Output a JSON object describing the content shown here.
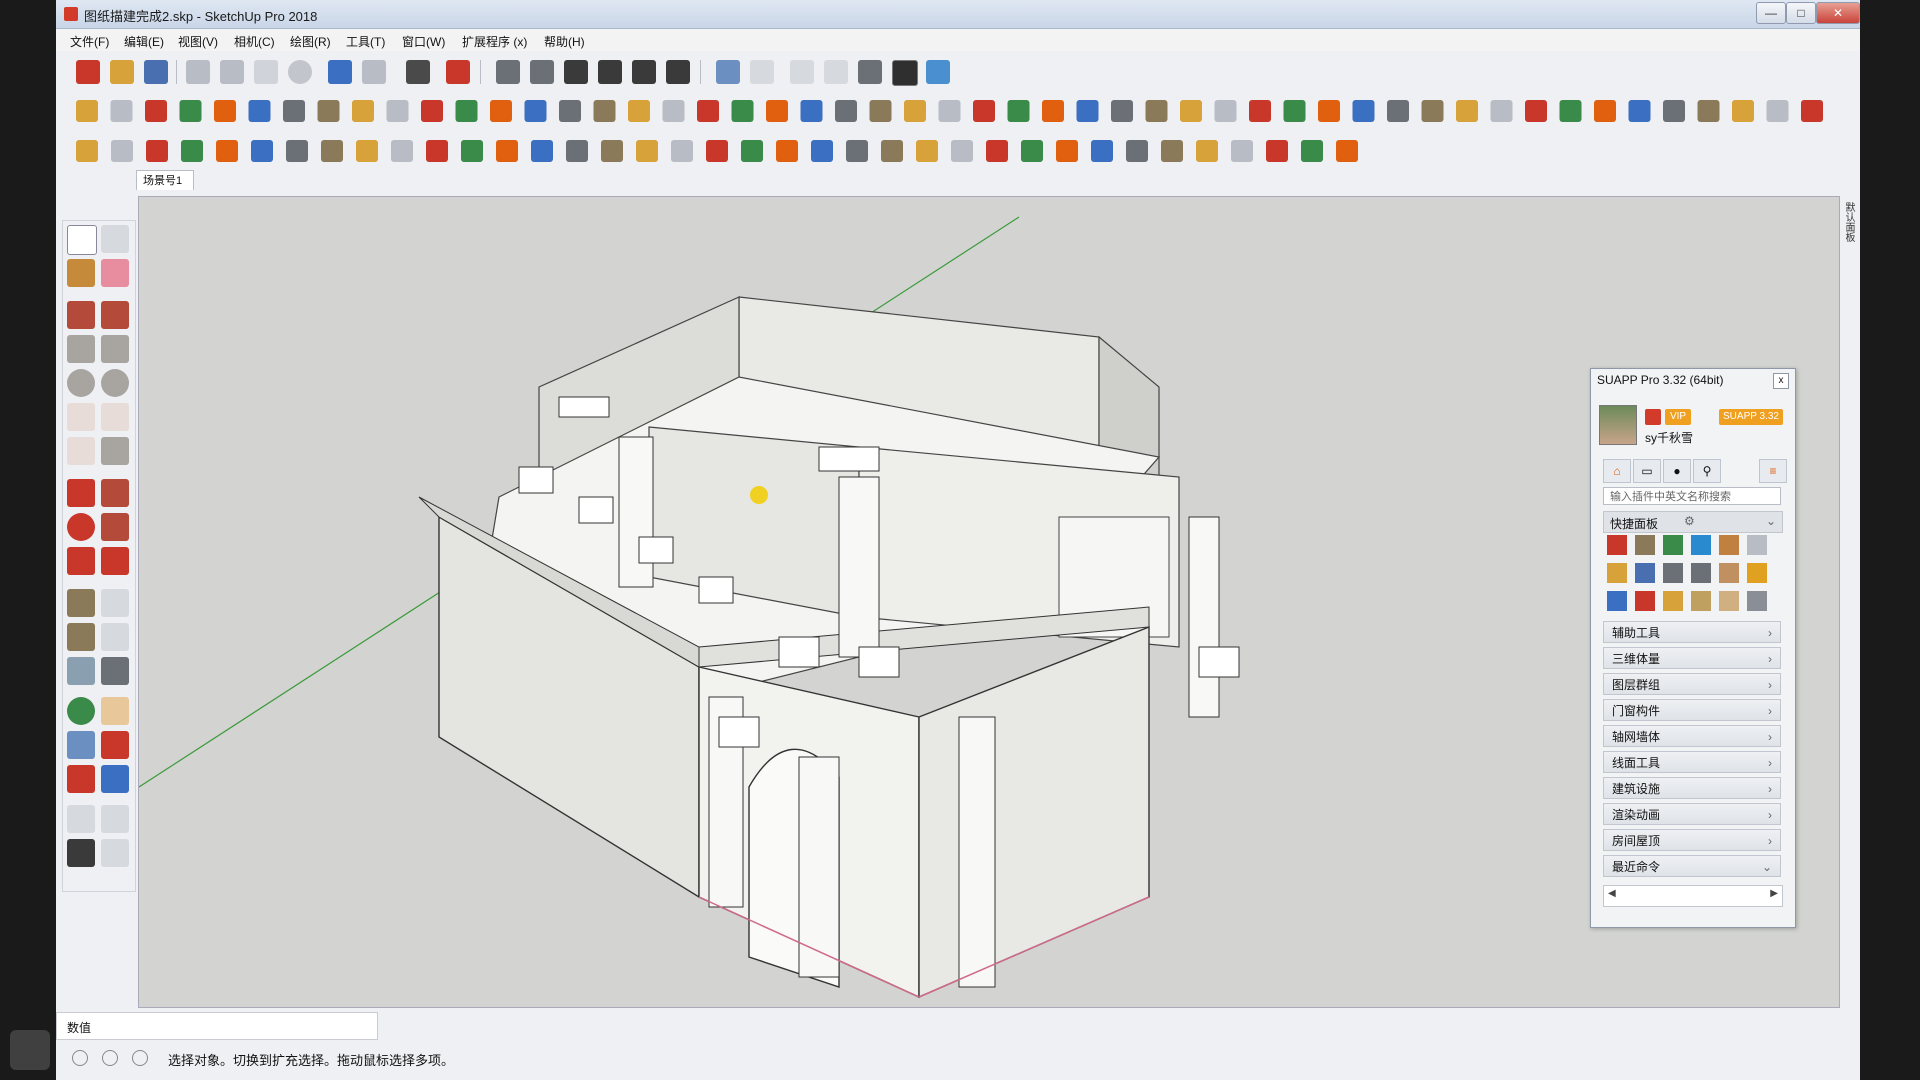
{
  "window": {
    "title": "图纸描建完成2.skp - SketchUp Pro 2018",
    "controls": {
      "minimize": "—",
      "maximize": "□",
      "close": "✕"
    }
  },
  "menu": [
    "文件(F)",
    "编辑(E)",
    "视图(V)",
    "相机(C)",
    "绘图(R)",
    "工具(T)",
    "窗口(W)",
    "扩展程序 (x)",
    "帮助(H)"
  ],
  "scene_tab": "场景号1",
  "right_strip_label": "默认面板",
  "suapp": {
    "title": "SUAPP Pro 3.32 (64bit)",
    "close": "x",
    "user": "sy千秋雪",
    "badge_vip": "VIP",
    "badge_version": "SUAPP 3.32",
    "search_placeholder": "输入插件中英文名称搜索",
    "quick_panel": "快捷面板",
    "categories": [
      "辅助工具",
      "三维体量",
      "图层群组",
      "门窗构件",
      "轴网墙体",
      "线面工具",
      "建筑设施",
      "渲染动画",
      "房间屋顶",
      "最近命令"
    ]
  },
  "status": {
    "data_label": "数值",
    "message": "选择对象。切换到扩充选择。拖动鼠标选择多项。"
  },
  "colors": {
    "accent": "#d23a2a",
    "viewport_bg": "#d3d4d1",
    "axis_green": "#3a9a3a",
    "badge_orange": "#f0a020"
  }
}
